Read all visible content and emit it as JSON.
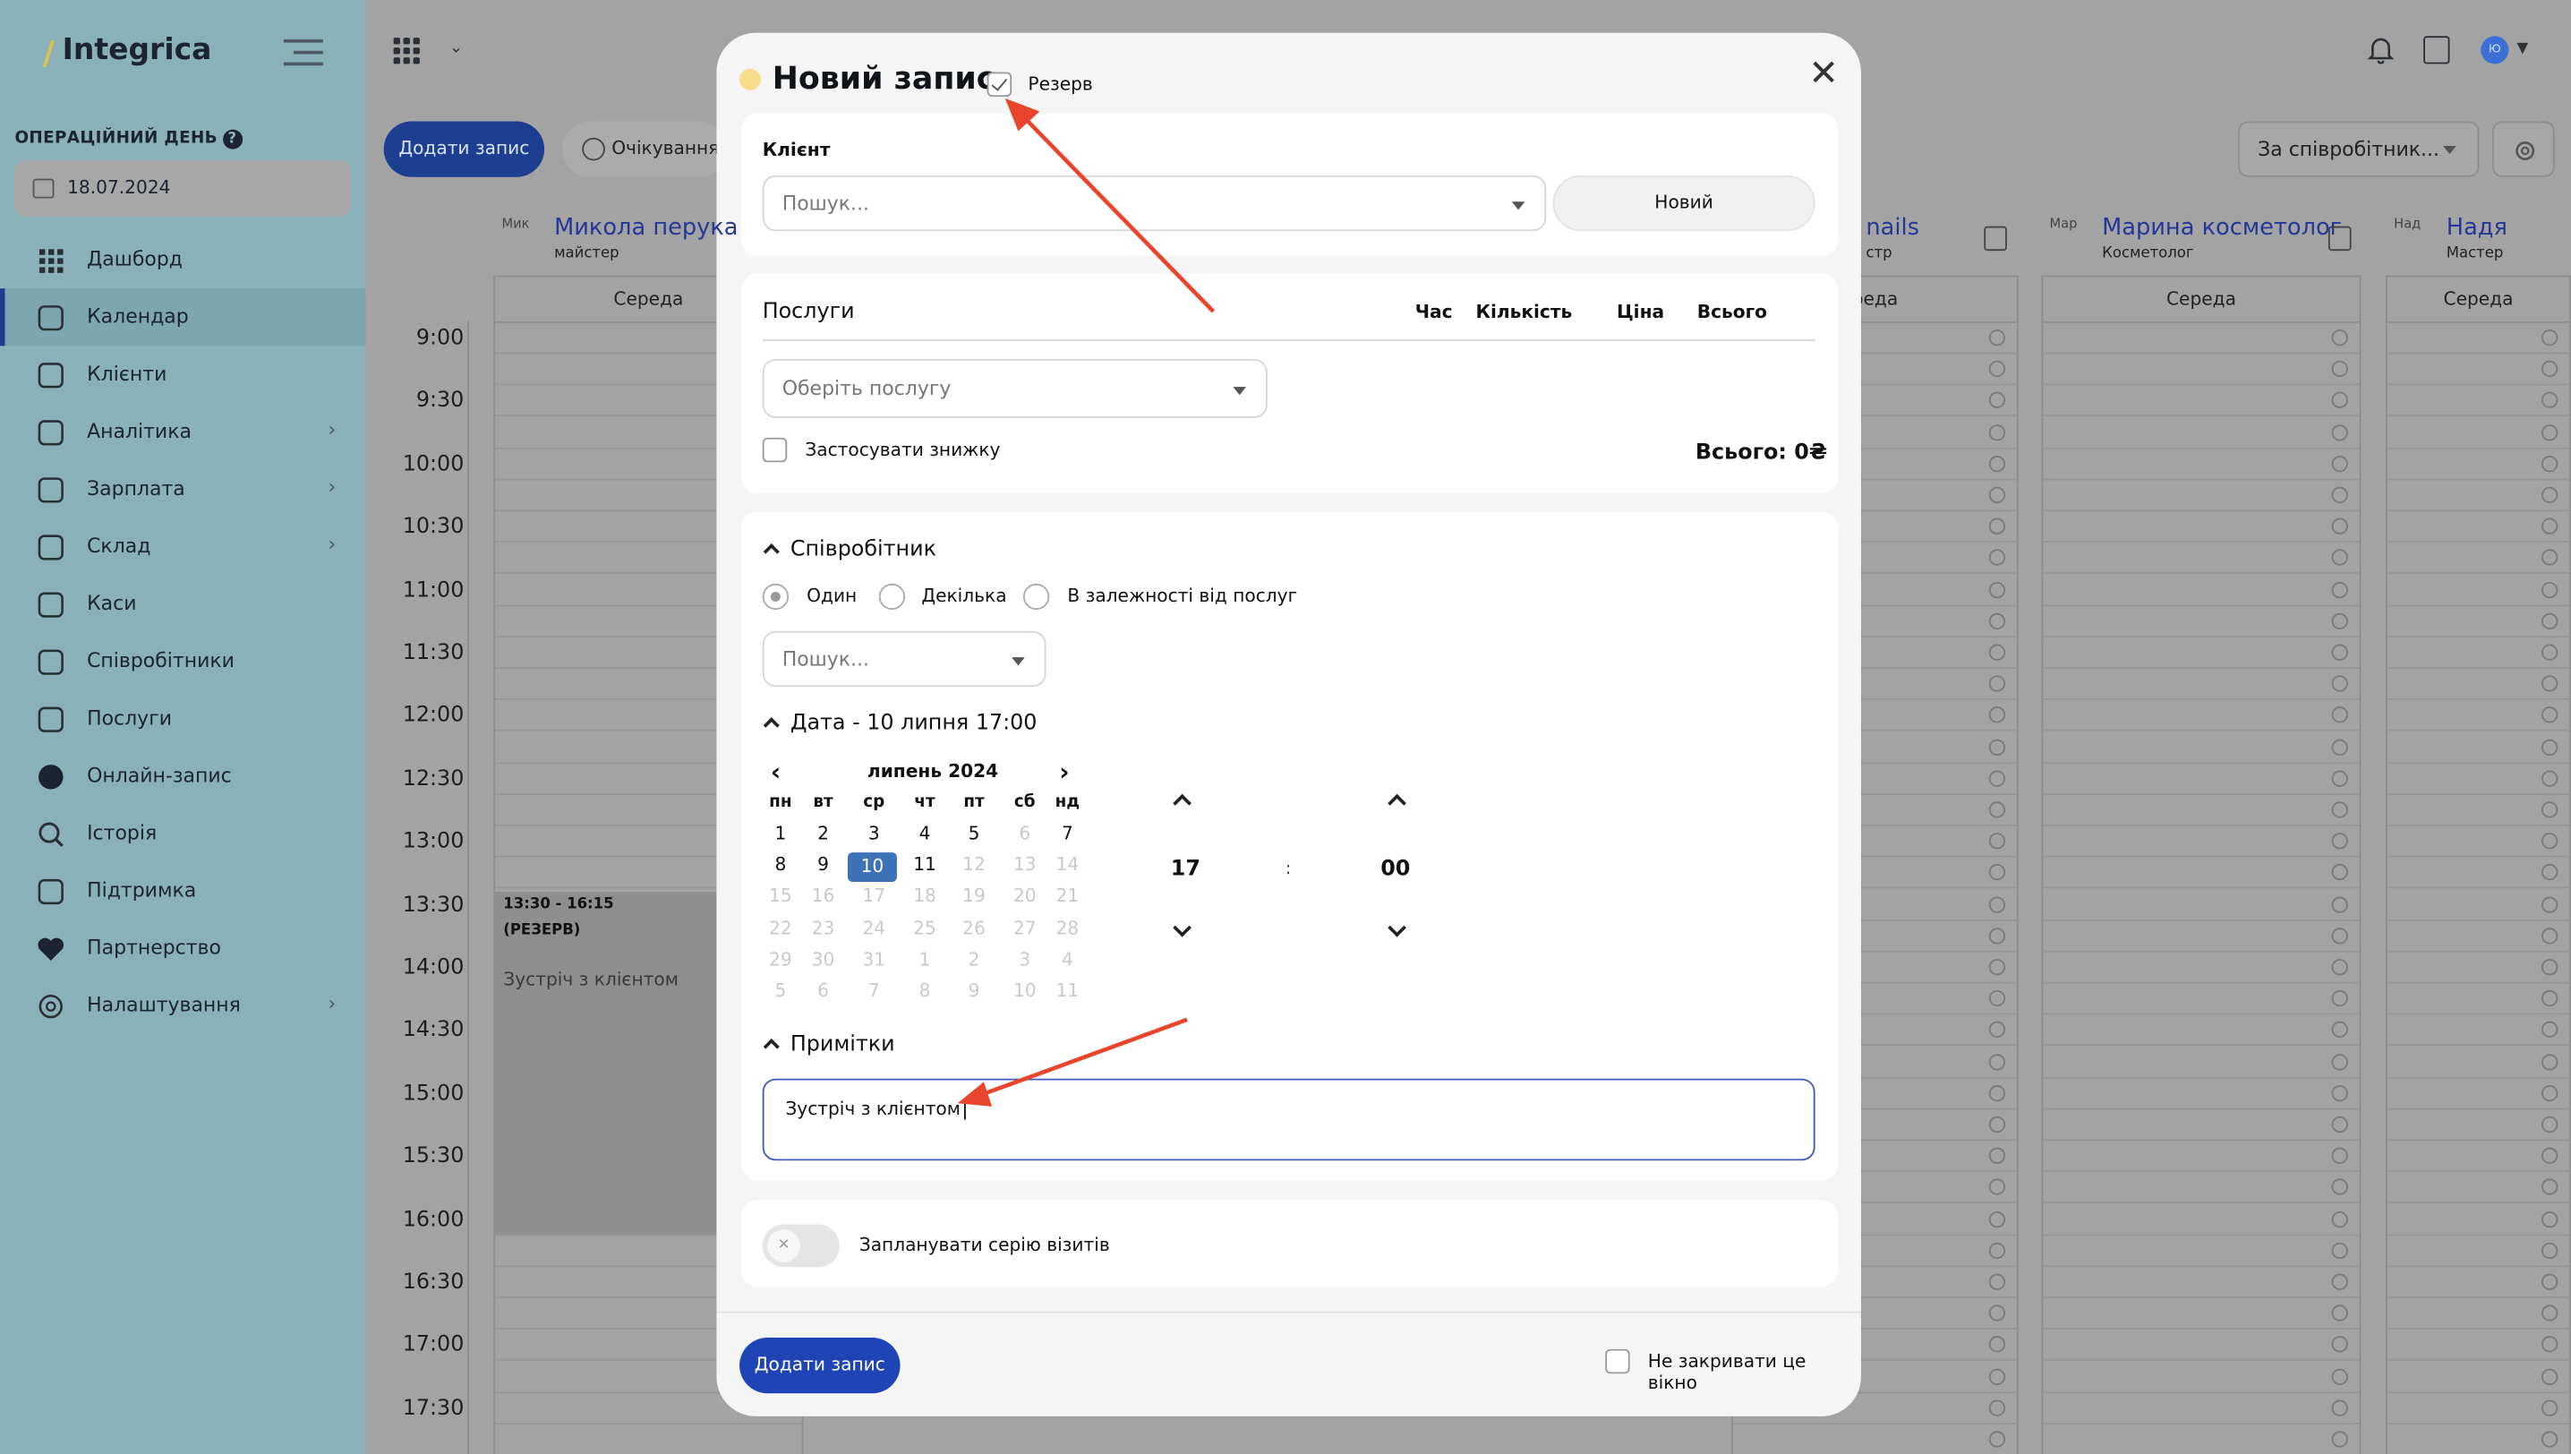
{
  "app": {
    "logo_text": "Integrica"
  },
  "sidebar": {
    "operational_day_label": "ОПЕРАЦІЙНИЙ ДЕНЬ",
    "date": "18.07.2024",
    "items": [
      {
        "label": "Дашборд",
        "icon": "grid-icon"
      },
      {
        "label": "Календар",
        "icon": "calendar-icon",
        "active": true
      },
      {
        "label": "Клієнти",
        "icon": "users-icon"
      },
      {
        "label": "Аналітика",
        "icon": "chart-icon",
        "has_submenu": true
      },
      {
        "label": "Зарплата",
        "icon": "clipboard-icon",
        "has_submenu": true
      },
      {
        "label": "Склад",
        "icon": "warehouse-icon",
        "has_submenu": true
      },
      {
        "label": "Каси",
        "icon": "cash-icon"
      },
      {
        "label": "Співробітники",
        "icon": "person-icon"
      },
      {
        "label": "Послуги",
        "icon": "coffee-icon"
      },
      {
        "label": "Онлайн-запис",
        "icon": "telegram-icon"
      },
      {
        "label": "Історія",
        "icon": "search-icon"
      },
      {
        "label": "Підтримка",
        "icon": "phone-icon"
      },
      {
        "label": "Партнерство",
        "icon": "heart-icon"
      },
      {
        "label": "Налаштування",
        "icon": "gear-icon",
        "has_submenu": true
      }
    ]
  },
  "toolbar": {
    "add_record": "Додати запис",
    "waiting": "Очікування",
    "staff_filter": "За співробітник..."
  },
  "calendar": {
    "times": [
      "9:00",
      "9:30",
      "10:00",
      "10:30",
      "11:00",
      "11:30",
      "12:00",
      "12:30",
      "13:00",
      "13:30",
      "14:00",
      "14:30",
      "15:00",
      "15:30",
      "16:00",
      "16:30",
      "17:00",
      "17:30"
    ],
    "staff": [
      {
        "photo": "Мик",
        "name": "Микола перука",
        "role": "майстер",
        "day": "Середа"
      },
      {
        "name": "nails",
        "role": "стр",
        "day": "реда"
      },
      {
        "photo": "Мар",
        "name": "Марина косметолог",
        "role": "Косметолог",
        "day": "Середа"
      },
      {
        "photo": "Над",
        "name": "Надя",
        "role": "Мастер",
        "day": "Середа"
      }
    ],
    "event": {
      "time": "13:30 - 16:15",
      "tag": "(РЕЗЕРВ)",
      "note": "Зустріч з клієнтом"
    }
  },
  "modal": {
    "title": "Новий запис",
    "reserve_label": "Резерв",
    "reserve_checked": true,
    "client_label": "Клієнт",
    "client_placeholder": "Пошук...",
    "new_client": "Новий",
    "services_label": "Послуги",
    "col_time": "Час",
    "col_qty": "Кількість",
    "col_price": "Ціна",
    "col_total": "Всього",
    "service_placeholder": "Оберіть послугу",
    "discount_label": "Застосувати знижку",
    "total": "Всього: 0₴",
    "employee_section": "Співробітник",
    "radio_one": "Один",
    "radio_several": "Декілька",
    "radio_dep": "В залежності від послуг",
    "employee_placeholder": "Пошук...",
    "date_section": "Дата - 10 липня 17:00",
    "month": "липень 2024",
    "weekdays": [
      "пн",
      "вт",
      "ср",
      "чт",
      "пт",
      "сб",
      "нд"
    ],
    "weeks": [
      [
        "1",
        "2",
        "3",
        "4",
        "5",
        "6",
        "7"
      ],
      [
        "8",
        "9",
        "10",
        "11",
        "12",
        "13",
        "14"
      ],
      [
        "15",
        "16",
        "17",
        "18",
        "19",
        "20",
        "21"
      ],
      [
        "22",
        "23",
        "24",
        "25",
        "26",
        "27",
        "28"
      ],
      [
        "29",
        "30",
        "31",
        "1",
        "2",
        "3",
        "4"
      ],
      [
        "5",
        "6",
        "7",
        "8",
        "9",
        "10",
        "11"
      ]
    ],
    "selected_day": "10",
    "hour": "17",
    "separator": ":",
    "minute": "00",
    "notes_section": "Примітки",
    "notes_value": "Зустріч з клієнтом",
    "series_label": "Запланувати серію візитів",
    "submit": "Додати запис",
    "keep_open": "Не закривати це вікно"
  },
  "colors": {
    "sidebar_bg": "#8ab0b9",
    "primary": "#1e44b6",
    "annotation_arrow": "#e8452c"
  }
}
